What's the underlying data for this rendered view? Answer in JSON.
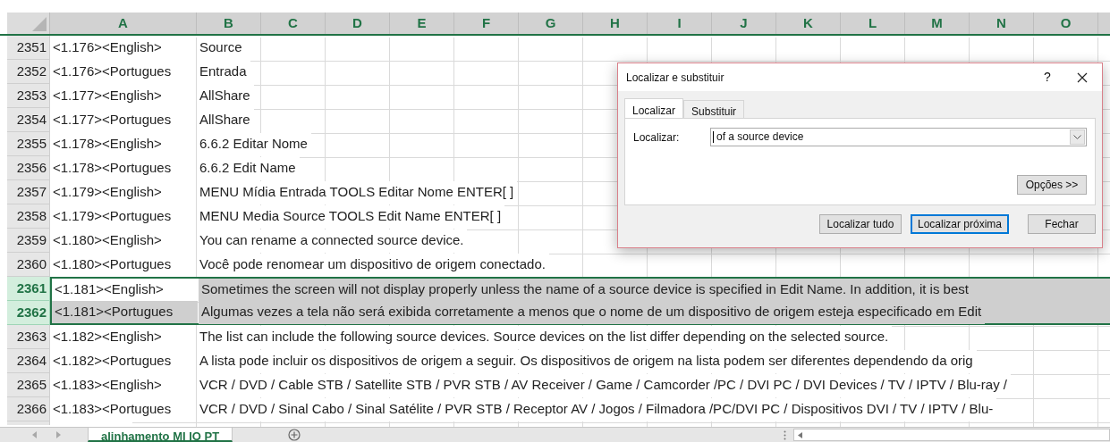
{
  "columns": [
    "A",
    "B",
    "C",
    "D",
    "E",
    "F",
    "G",
    "H",
    "I",
    "J",
    "K",
    "L",
    "M",
    "N",
    "O"
  ],
  "rows": [
    {
      "number": "2351",
      "col_a": "<1.176><English>",
      "col_b": "Source",
      "selected": false,
      "active": false
    },
    {
      "number": "2352",
      "col_a": "<1.176><Portugues",
      "col_b": "Entrada",
      "selected": false,
      "active": false
    },
    {
      "number": "2353",
      "col_a": "<1.177><English>",
      "col_b": "AllShare",
      "selected": false,
      "active": false
    },
    {
      "number": "2354",
      "col_a": "<1.177><Portugues",
      "col_b": "AllShare",
      "selected": false,
      "active": false
    },
    {
      "number": "2355",
      "col_a": "<1.178><English>",
      "col_b": "6.6.2 Editar Nome",
      "selected": false,
      "active": false
    },
    {
      "number": "2356",
      "col_a": "<1.178><Portugues",
      "col_b": "6.6.2 Edit Name",
      "selected": false,
      "active": false
    },
    {
      "number": "2357",
      "col_a": "<1.179><English>",
      "col_b": "MENU Mídia Entrada TOOLS Editar Nome ENTER[ ]",
      "selected": false,
      "active": false
    },
    {
      "number": "2358",
      "col_a": "<1.179><Portugues",
      "col_b": "MENU Media Source TOOLS Edit Name ENTER[ ]",
      "selected": false,
      "active": false
    },
    {
      "number": "2359",
      "col_a": "<1.180><English>",
      "col_b": "You can rename a connected source device.",
      "selected": false,
      "active": false
    },
    {
      "number": "2360",
      "col_a": "<1.180><Portugues",
      "col_b": "Você pode renomear um dispositivo de origem conectado.",
      "selected": false,
      "active": false
    },
    {
      "number": "2361",
      "col_a": "<1.181><English>",
      "col_b": "Sometimes the screen will not display properly unless the name of a source device is specified in Edit Name. In addition, it is best",
      "selected": true,
      "active": true
    },
    {
      "number": "2362",
      "col_a": "<1.181><Portugues",
      "col_b": "Algumas vezes a tela não será exibida corretamente a menos que o nome de um dispositivo de origem esteja especificado em Edit",
      "selected": true,
      "active": false
    },
    {
      "number": "2363",
      "col_a": "<1.182><English>",
      "col_b": "The list can include the following source devices. Source devices on the list differ depending on the selected source.",
      "selected": false,
      "active": false
    },
    {
      "number": "2364",
      "col_a": "<1.182><Portugues",
      "col_b": "A lista pode incluir os dispositivos de origem a seguir. Os dispositivos de origem na lista podem ser diferentes dependendo da orig",
      "selected": false,
      "active": false
    },
    {
      "number": "2365",
      "col_a": "<1.183><English>",
      "col_b": "VCR / DVD / Cable STB / Satellite STB / PVR STB / AV Receiver / Game / Camcorder /PC / DVI PC / DVI Devices / TV / IPTV / Blu-ray /",
      "selected": false,
      "active": false
    },
    {
      "number": "2366",
      "col_a": "<1.183><Portugues",
      "col_b": "VCR / DVD / Sinal Cabo / Sinal Satélite / PVR STB / Receptor AV / Jogos / Filmadora /PC/DVI PC / Dispositivos DVI / TV / IPTV / Blu-",
      "selected": false,
      "active": false
    }
  ],
  "dialog": {
    "title": "Localizar e substituir",
    "help": "?",
    "tabs": [
      {
        "label": "Localizar",
        "selected": true
      },
      {
        "label": "Substituir",
        "selected": false
      }
    ],
    "field_label": "Localizar:",
    "field_value": "of a source device",
    "options_button": "Opções >>",
    "buttons": [
      {
        "label": "Localizar tudo",
        "default": false
      },
      {
        "label": "Localizar próxima",
        "default": true
      },
      {
        "label": "Fechar",
        "default": false
      }
    ]
  },
  "sheet_tabs": [
    {
      "label": "alinhamento MI IO PT",
      "selected": true
    }
  ]
}
